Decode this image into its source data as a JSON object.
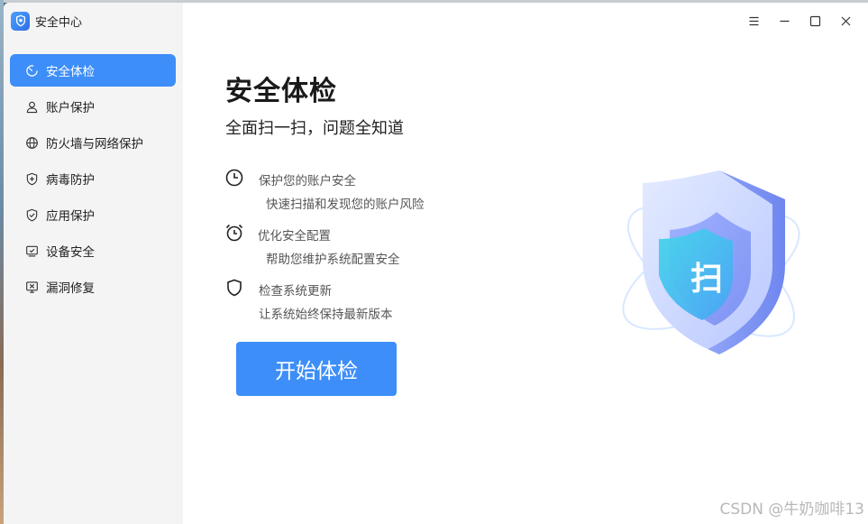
{
  "app": {
    "title": "安全中心"
  },
  "sidebar": {
    "items": [
      {
        "label": "安全体检",
        "icon": "scan-circle-icon",
        "active": true
      },
      {
        "label": "账户保护",
        "icon": "user-icon",
        "active": false
      },
      {
        "label": "防火墙与网络保护",
        "icon": "globe-icon",
        "active": false
      },
      {
        "label": "病毒防护",
        "icon": "shield-plus-icon",
        "active": false
      },
      {
        "label": "应用保护",
        "icon": "shield-check-icon",
        "active": false
      },
      {
        "label": "设备安全",
        "icon": "device-check-icon",
        "active": false
      },
      {
        "label": "漏洞修复",
        "icon": "monitor-bug-icon",
        "active": false
      }
    ]
  },
  "window_controls": {
    "menu": "menu-icon",
    "minimize": "minimize-icon",
    "maximize": "maximize-icon",
    "close": "close-icon"
  },
  "main": {
    "title": "安全体检",
    "subtitle": "全面扫一扫，问题全知道",
    "features": [
      {
        "heading": "保护您的账户安全",
        "desc": "快速扫描和发现您的账户风险",
        "icon": "clock-icon"
      },
      {
        "heading": "优化安全配置",
        "desc": "帮助您维护系统配置安全",
        "icon": "alarm-clock-icon"
      },
      {
        "heading": "检查系统更新",
        "desc": "让系统始终保持最新版本",
        "icon": "shield-outline-icon"
      }
    ],
    "start_button": "开始体检",
    "hero": {
      "icon": "security-scan-shield-icon",
      "glyph": "扫"
    }
  },
  "watermark": "CSDN @牛奶咖啡13",
  "colors": {
    "accent": "#3d8ef8",
    "sidebar_bg": "#f4f4f5"
  }
}
